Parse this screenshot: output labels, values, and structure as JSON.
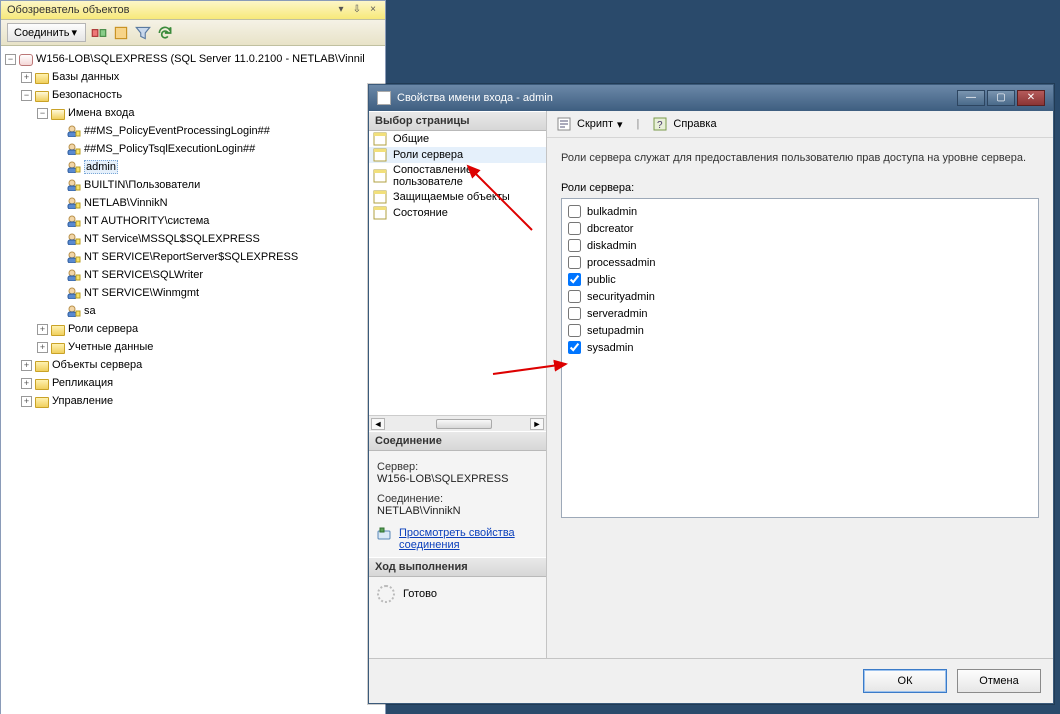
{
  "explorer": {
    "title": "Обозреватель объектов",
    "connect_label": "Соединить",
    "root_label": "W156-LOB\\SQLEXPRESS (SQL Server 11.0.2100 - NETLAB\\Vinnil",
    "nodes": {
      "databases": "Базы данных",
      "security": "Безопасность",
      "logins": "Имена входа",
      "server_roles": "Роли сервера",
      "credentials": "Учетные данные",
      "server_objects": "Объекты сервера",
      "replication": "Репликация",
      "management": "Управление"
    },
    "login_items": [
      "##MS_PolicyEventProcessingLogin##",
      "##MS_PolicyTsqlExecutionLogin##",
      "admin",
      "BUILTIN\\Пользователи",
      "NETLAB\\VinnikN",
      "NT AUTHORITY\\система",
      "NT Service\\MSSQL$SQLEXPRESS",
      "NT SERVICE\\ReportServer$SQLEXPRESS",
      "NT SERVICE\\SQLWriter",
      "NT SERVICE\\Winmgmt",
      "sa"
    ]
  },
  "dialog": {
    "title": "Свойства имени входа - admin",
    "page_header": "Выбор страницы",
    "pages": [
      "Общие",
      "Роли сервера",
      "Сопоставление пользователе",
      "Защищаемые объекты",
      "Состояние"
    ],
    "toolbar": {
      "script": "Скрипт",
      "help": "Справка"
    },
    "description": "Роли сервера служат для предоставления пользователю прав доступа на уровне сервера.",
    "roles_label": "Роли сервера:",
    "roles": [
      {
        "name": "bulkadmin",
        "checked": false
      },
      {
        "name": "dbcreator",
        "checked": false
      },
      {
        "name": "diskadmin",
        "checked": false
      },
      {
        "name": "processadmin",
        "checked": false
      },
      {
        "name": "public",
        "checked": true
      },
      {
        "name": "securityadmin",
        "checked": false
      },
      {
        "name": "serveradmin",
        "checked": false
      },
      {
        "name": "setupadmin",
        "checked": false
      },
      {
        "name": "sysadmin",
        "checked": true
      }
    ],
    "connection": {
      "header": "Соединение",
      "server_label": "Сервер:",
      "server_value": "W156-LOB\\SQLEXPRESS",
      "conn_label": "Соединение:",
      "conn_value": "NETLAB\\VinnikN",
      "view_props": "Просмотреть свойства соединения"
    },
    "progress": {
      "header": "Ход выполнения",
      "status": "Готово"
    },
    "buttons": {
      "ok": "ОК",
      "cancel": "Отмена"
    }
  }
}
